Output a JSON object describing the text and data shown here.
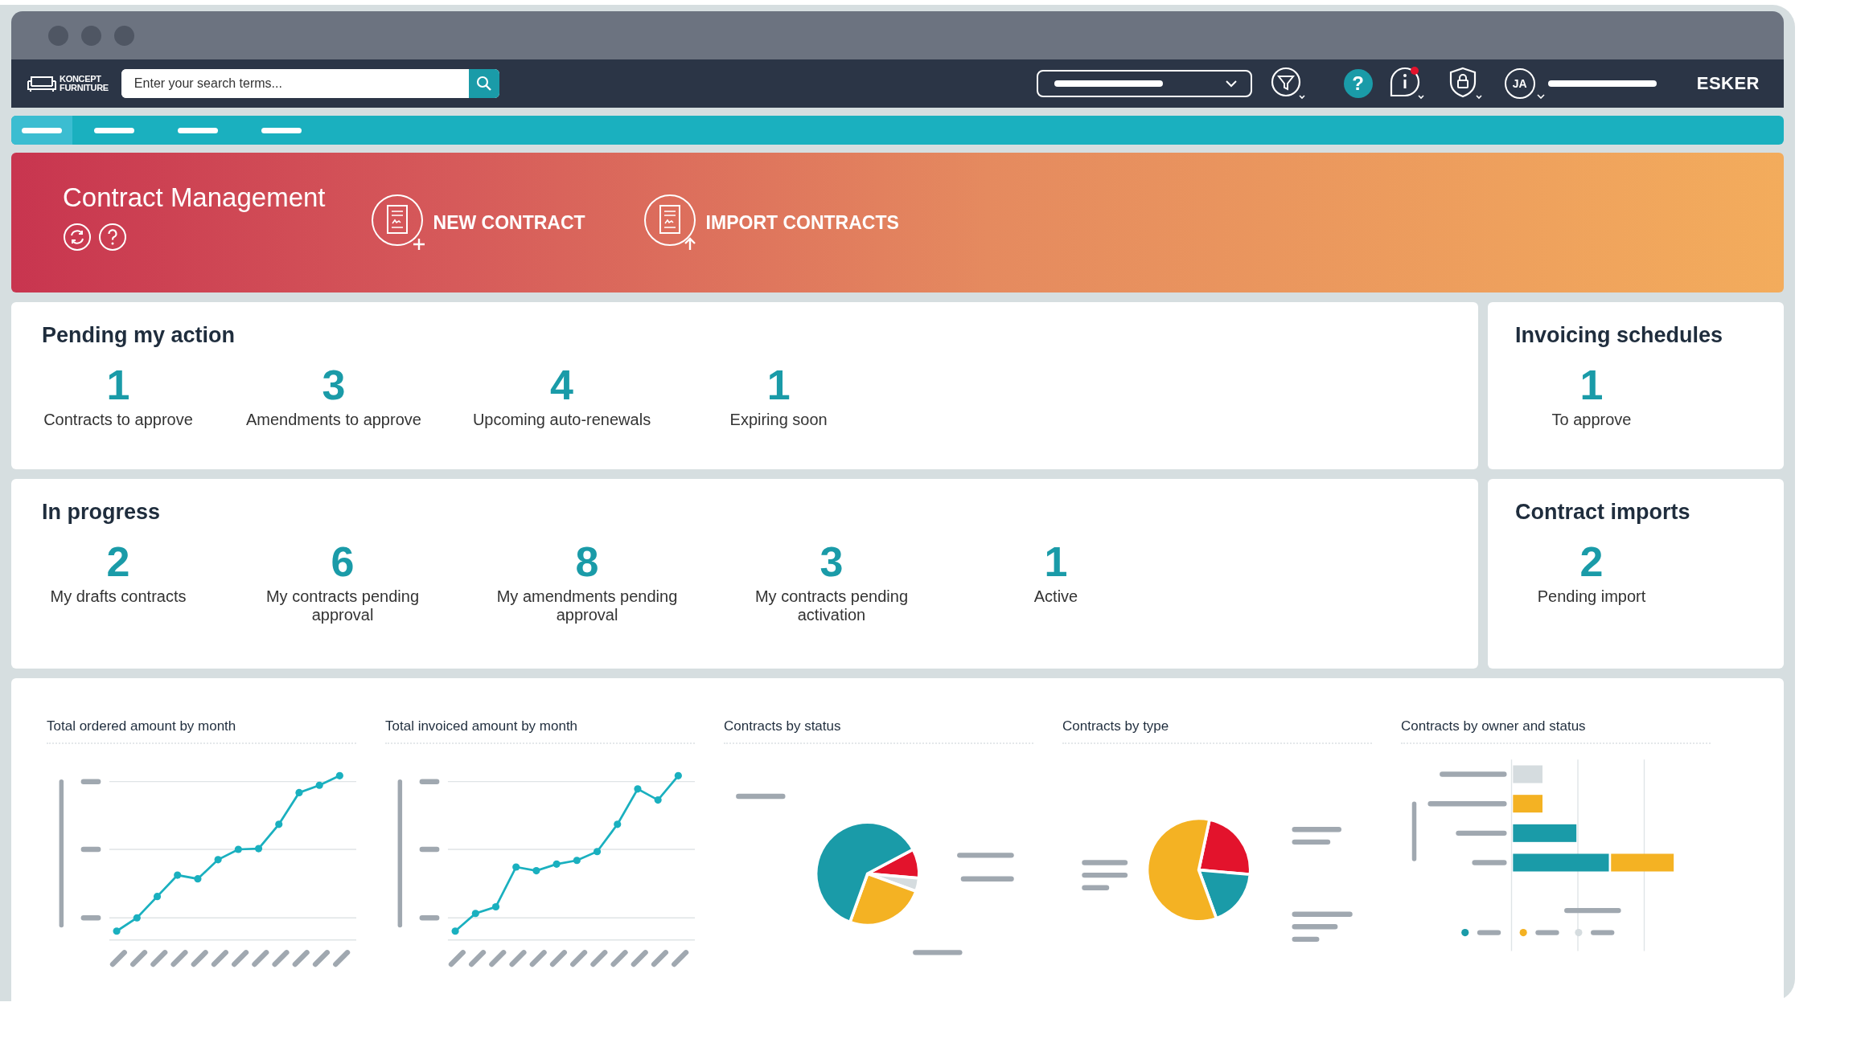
{
  "navbar": {
    "logo": {
      "line1": "KONCEPT",
      "line2": "FURNITURE"
    },
    "search": {
      "placeholder": "Enter your search terms..."
    },
    "help": "?",
    "avatar": "JA",
    "brand": "ESKER",
    "notification": true
  },
  "nav_tabs": [
    {
      "selected": true
    },
    {
      "selected": false
    },
    {
      "selected": false
    },
    {
      "selected": false
    }
  ],
  "banner": {
    "title": "Contract Management",
    "actions": [
      {
        "kind": "new",
        "label": "NEW CONTRACT"
      },
      {
        "kind": "import",
        "label": "IMPORT CONTRACTS"
      }
    ]
  },
  "sections": [
    {
      "title": "Pending my action",
      "stats": [
        {
          "value": "1",
          "label": "Contracts to approve"
        },
        {
          "value": "3",
          "label": "Amendments to approve"
        },
        {
          "value": "4",
          "label": "Upcoming auto-renewals"
        },
        {
          "value": "1",
          "label": "Expiring soon"
        }
      ]
    },
    {
      "title": "Invoicing schedules",
      "stats": [
        {
          "value": "1",
          "label": "To approve"
        }
      ]
    },
    {
      "title": "In progress",
      "stats": [
        {
          "value": "2",
          "label": "My drafts contracts"
        },
        {
          "value": "6",
          "label": "My contracts pending approval"
        },
        {
          "value": "8",
          "label": "My amendments pending approval"
        },
        {
          "value": "3",
          "label": "My contracts pending activation"
        },
        {
          "value": "1",
          "label": "Active"
        }
      ]
    },
    {
      "title": "Contract imports",
      "stats": [
        {
          "value": "2",
          "label": "Pending import"
        }
      ]
    }
  ],
  "charts": [
    {
      "kind": "line",
      "title": "Total ordered amount by month"
    },
    {
      "kind": "line",
      "title": "Total invoiced amount by month"
    },
    {
      "kind": "pie",
      "title": "Contracts by status"
    },
    {
      "kind": "pie",
      "title": "Contracts by type"
    },
    {
      "kind": "bar",
      "title": "Contracts by owner and status"
    }
  ]
}
